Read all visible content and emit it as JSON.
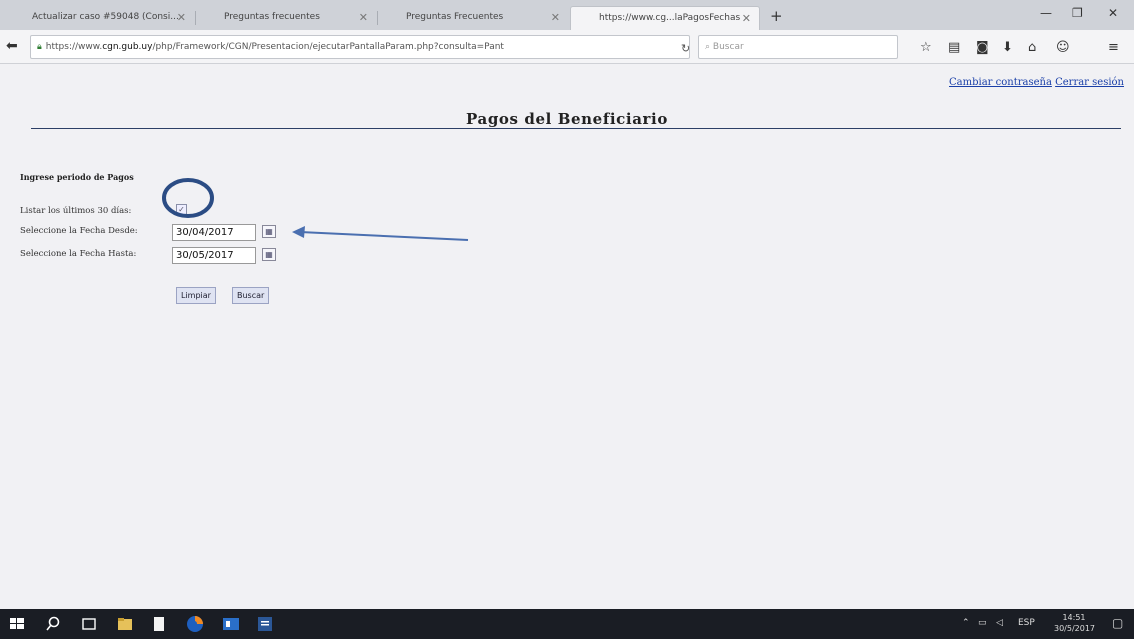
{
  "browser": {
    "tabs": [
      {
        "label": "Actualizar caso #59048 (Consi..."
      },
      {
        "label": "Preguntas frecuentes"
      },
      {
        "label": "Preguntas Frecuentes"
      },
      {
        "label": "https://www.cg...laPagosFechas"
      }
    ],
    "url_prefix": "https://www.",
    "url_domain": "cgn.gub.uy",
    "url_rest": "/php/Framework/CGN/Presentacion/ejecutarPantallaParam.php?consulta=Pant",
    "search_placeholder": "Buscar"
  },
  "page": {
    "links": {
      "change_password": "Cambiar contraseña",
      "logout": "Cerrar sesión"
    },
    "title": "Pagos del Beneficiario",
    "section_label": "Ingrese periodo de Pagos",
    "form": {
      "last30_label": "Listar los últimos 30 días:",
      "last30_checked": true,
      "from_label": "Seleccione la Fecha Desde:",
      "from_value": "30/04/2017",
      "to_label": "Seleccione la Fecha Hasta:",
      "to_value": "30/05/2017",
      "clear_label": "Limpiar",
      "search_label": "Buscar"
    }
  },
  "annotation": {
    "circle_color": "#2b4c84",
    "arrow_color": "#4a6fb0"
  },
  "taskbar": {
    "time": "14:51",
    "date": "30/5/2017",
    "lang": "ESP"
  }
}
